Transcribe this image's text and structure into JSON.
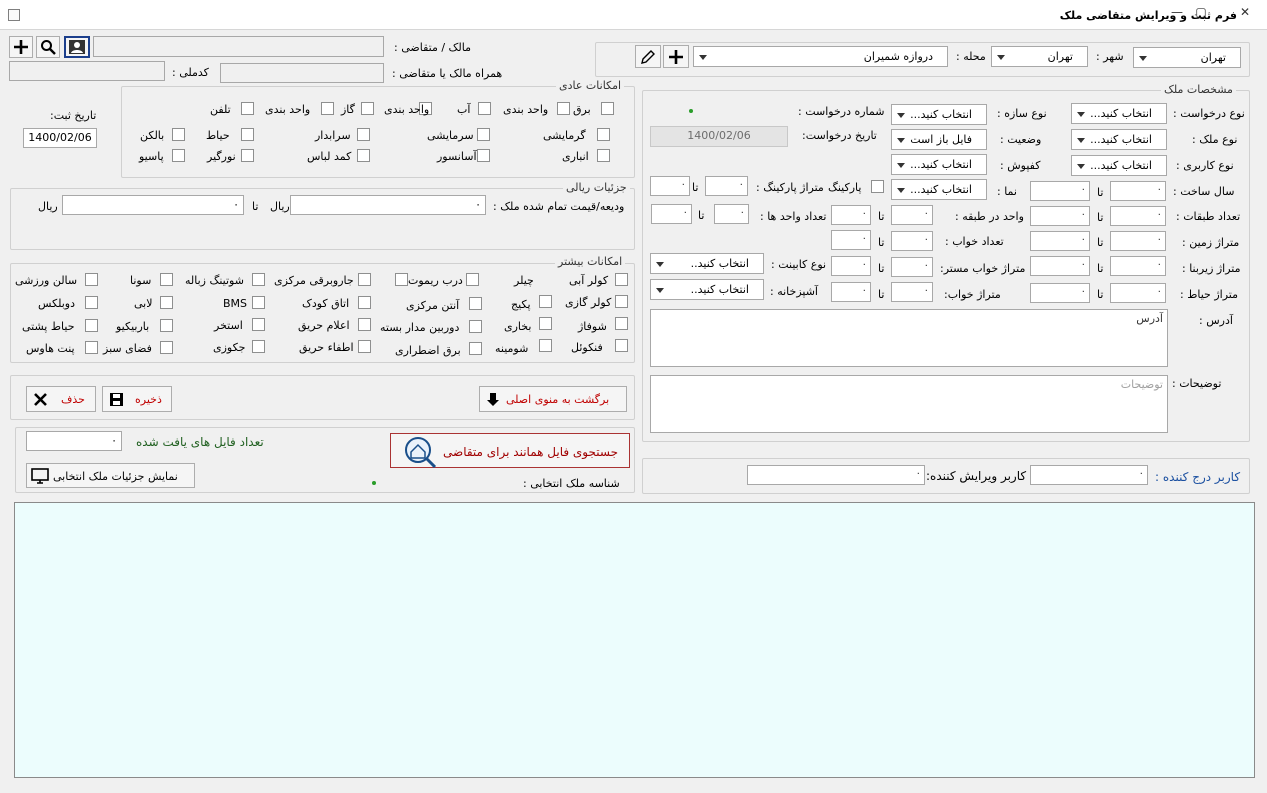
{
  "window": {
    "title": "فرم ثبت و ویرایش متقاضی ملک",
    "min": "—",
    "max": "▢",
    "close": "✕"
  },
  "owner": {
    "owner_label": "مالک / متقاضی :",
    "mobile_label": "همراه مالک یا متقاضی :",
    "national_label": "کدملی :",
    "owner_value": "",
    "mobile_value": "",
    "national_value": ""
  },
  "location": {
    "city_label": "شهر :",
    "city_value": "تهران",
    "region_label": "محله :",
    "region_value": "تهران",
    "neighborhood_value": "دروازه شمیران"
  },
  "reg_date": {
    "label": "تاریخ ثبت:",
    "value": "1400/02/06"
  },
  "basic_amenities": {
    "title": "امکانات عادی",
    "items": [
      "برق",
      "واحد بندی",
      "آب",
      "واحد بندی",
      "گاز",
      "واحد بندی",
      "تلفن",
      "گرمایشی",
      "سرمایشی",
      "سرابدار",
      "حیاط",
      "بالکن",
      "انباری",
      "آسانسور",
      "کمد لباس",
      "نورگیر",
      "پاسیو"
    ]
  },
  "price": {
    "title": "جزئیات ریالی",
    "label": "ودیعه/قیمت تمام شده ملک :",
    "rial1": "ریال",
    "to": "تا",
    "rial2": "ریال",
    "from_value": "۰",
    "to_value": "۰"
  },
  "more_amenities": {
    "title": "امکانات بیشتر",
    "items": [
      "کولر آبی",
      "چیلر",
      "درب ریموت",
      "جاروبرقی مرکزی",
      "شوتینگ زباله",
      "سونا",
      "سالن ورزشی",
      "کولر گازی",
      "پکیج",
      "آنتن مرکزی",
      "اتاق کودک",
      "BMS",
      "لابی",
      "دوبلکس",
      "شوفاژ",
      "بخاری",
      "دوربین مدار بسته",
      "اعلام حریق",
      "استخر",
      "باربیکیو",
      "حیاط پشتی",
      "فنکوئل",
      "شومینه",
      "برق اضطراری",
      "اطفاء حریق",
      "جکوزی",
      "فضای سبز",
      "پنت هاوس"
    ]
  },
  "actions": {
    "back_label": "برگشت به منوی اصلی",
    "save_label": "ذخیره",
    "delete_label": "حذف"
  },
  "search": {
    "count_label": "تعداد فایل های یافت شده",
    "count_value": "۰",
    "search_label": "جستجوی فایل همانند برای متقاضی",
    "show_label": "نمایش جزئیات ملک انتخابی",
    "selected_label": "شناسه ملک انتخابی :"
  },
  "property": {
    "title": "مشخصات ملک",
    "request_type_label": "نوع درخواست :",
    "request_type_value": "انتخاب کنید...",
    "build_type_label": "نوع سازه :",
    "build_type_value": "انتخاب کنید...",
    "request_no_label": "شماره درخواست :",
    "property_type_label": "نوع ملک :",
    "property_type_value": "انتخاب کنید...",
    "status_label": "وضعیت :",
    "status_value": "فایل باز است",
    "request_date_label": "تاریخ درخواست:",
    "request_date_value": "1400/02/06",
    "usage_label": "نوع کاربری :",
    "usage_value": "انتخاب کنید...",
    "floor_cover_label": "کفپوش :",
    "floor_cover_value": "انتخاب کنید...",
    "build_year_label": "سال ساخت :",
    "facade_label": "نما :",
    "facade_value": "انتخاب کنید...",
    "parking_label": "پارکینگ",
    "parking_area_label": "متراژ پارکینگ :",
    "floors_label": "تعداد طبقات :",
    "units_floor_label": "واحد در طبقه :",
    "units_label": "تعداد واحد ها :",
    "land_area_label": "متراژ زمین :",
    "bedrooms_label": "تعداد  خواب :",
    "built_area_label": "متراژ زیربنا :",
    "master_label": "متراژ خواب مستر:",
    "cabinet_label": "نوع کابینت :",
    "cabinet_value": "انتخاب کنید..",
    "yard_label": "متراژ حیاط :",
    "bedroom_area_label": "متراژ خواب:",
    "kitchen_label": "آشپزخانه :",
    "kitchen_value": "انتخاب کنید..",
    "to": "تا",
    "zero": "۰",
    "address_label": "آدرس :",
    "address_placeholder": "آدرس",
    "desc_label": "توضیحات :",
    "desc_placeholder": "توضیحات"
  },
  "users": {
    "insert_label": "کاربر درج کننده :",
    "edit_label": "کاربر ویرایش کننده:",
    "insert_value": "۰",
    "edit_value": "۰"
  }
}
